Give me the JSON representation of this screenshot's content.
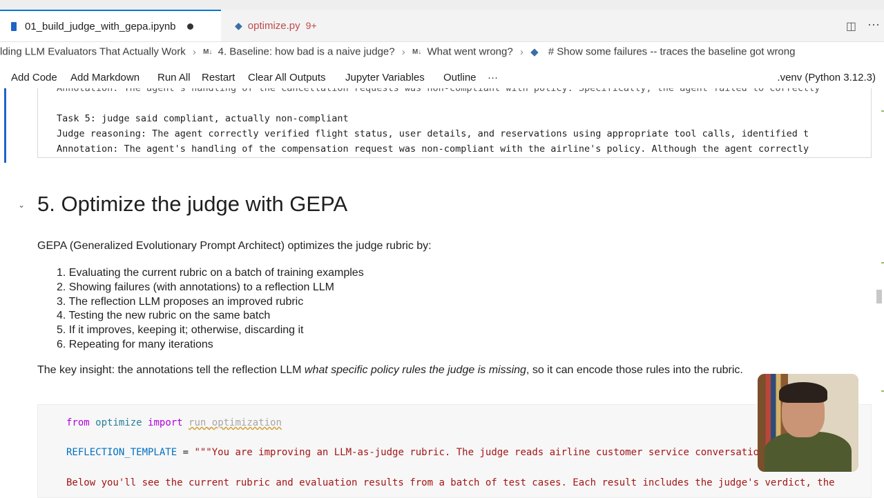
{
  "tabs": [
    {
      "label": "01_build_judge_with_gepa.ipynb",
      "icon": "notebook-icon",
      "unsaved": true
    },
    {
      "label": "optimize.py",
      "icon": "python-icon",
      "badge": "9+"
    }
  ],
  "breadcrumb": {
    "items": [
      {
        "marker": "",
        "label": "lding LLM Evaluators That Actually Work"
      },
      {
        "marker": "M↓",
        "label": "4. Baseline: how bad is a naive judge?"
      },
      {
        "marker": "M↓",
        "label": "What went wrong?"
      },
      {
        "marker": "python-icon",
        "label": "# Show some failures -- traces the baseline got wrong"
      }
    ]
  },
  "toolbar": {
    "add_code": "Add Code",
    "add_markdown": "Add Markdown",
    "run_all": "Run All",
    "restart": "Restart",
    "clear_outputs": "Clear All Outputs",
    "jupyter_variables": "Jupyter Variables",
    "outline": "Outline",
    "more": "···",
    "kernel": ".venv (Python 3.12.3)"
  },
  "output": {
    "lines": [
      "Annotation: The agent's handling of the cancellation requests was non-compliant with policy. Specifically, the agent failed to correctly",
      "",
      "Task 5: judge said compliant, actually non-compliant",
      "Judge reasoning: The agent correctly verified flight status, user details, and reservations using appropriate tool calls, identified t",
      "Annotation: The agent's handling of the compensation request was non-compliant with the airline's policy. Although the agent correctly"
    ]
  },
  "section": {
    "title": "5. Optimize the judge with GEPA",
    "intro": "GEPA (Generalized Evolutionary Prompt Architect) optimizes the judge rubric by:",
    "steps": [
      "1. Evaluating the current rubric on a batch of training examples",
      "2. Showing failures (with annotations) to a reflection LLM",
      "3. The reflection LLM proposes an improved rubric",
      "4. Testing the new rubric on the same batch",
      "5. If it improves, keeping it; otherwise, discarding it",
      "6. Repeating for many iterations"
    ],
    "insight_pre": "The key insight: the annotations tell the reflection LLM ",
    "insight_em": "what specific policy rules the judge is missing",
    "insight_post": ", so it can encode those rules into the rubric."
  },
  "code": {
    "from_kw": "from",
    "module": "optimize",
    "import_kw": "import",
    "func": "run_optimization",
    "var": "REFLECTION_TEMPLATE",
    "assign": " = ",
    "str1": "\"\"\"You are improving an LLM-as-judge rubric. The judge reads airline customer service conversations and decides",
    "str2": "Below you'll see the current rubric and evaluation results from a batch of test cases. Each result includes the judge's verdict, the"
  },
  "colors": {
    "accent": "#0078d4",
    "selection_bar": "#1d64c7",
    "keyword": "#af00db",
    "module": "#267f99",
    "variable": "#0070c1",
    "string": "#a31515"
  }
}
